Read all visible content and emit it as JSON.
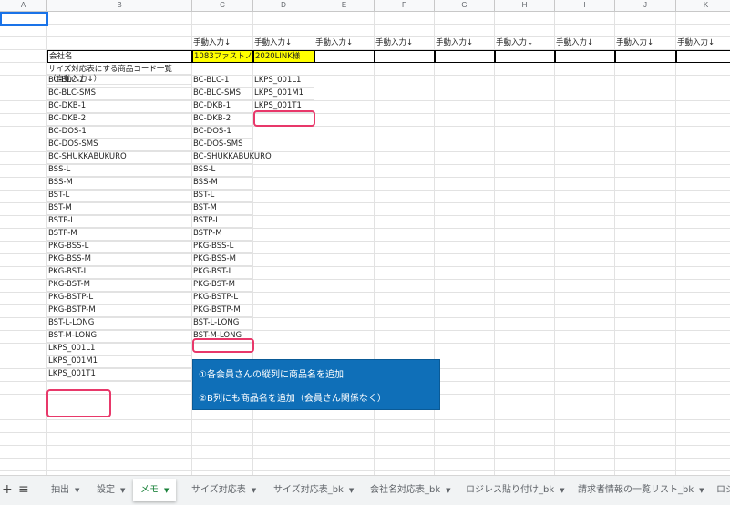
{
  "sheet": {
    "columns": [
      "A",
      "B",
      "C",
      "D",
      "E",
      "F",
      "G",
      "H",
      "I",
      "J",
      "K"
    ],
    "header_manual_input": "手動入力↓",
    "company_label": "会社名",
    "company_values": [
      "1083ファストノ",
      "2020LINK様"
    ],
    "size_list_label_line1": "サイズ対応表にする商品コード一覧",
    "size_list_label_line2": "（自動入力↓）",
    "col_b_codes": [
      "BC-BLC-1",
      "BC-BLC-SMS",
      "BC-DKB-1",
      "BC-DKB-2",
      "BC-DOS-1",
      "BC-DOS-SMS",
      "BC-SHUKKABUKURO",
      "BSS-L",
      "BSS-M",
      "BST-L",
      "BST-M",
      "BSTP-L",
      "BSTP-M",
      "PKG-BSS-L",
      "PKG-BSS-M",
      "PKG-BST-L",
      "PKG-BST-M",
      "PKG-BSTP-L",
      "PKG-BSTP-M",
      "BST-L-LONG",
      "BST-M-LONG",
      "LKPS_001L1",
      "LKPS_001M1",
      "LKPS_001T1"
    ],
    "col_c_codes": [
      "BC-BLC-1",
      "BC-BLC-SMS",
      "BC-DKB-1",
      "BC-DKB-2",
      "BC-DOS-1",
      "BC-DOS-SMS",
      "BC-SHUKKABUKURO",
      "BSS-L",
      "BSS-M",
      "BST-L",
      "BST-M",
      "BSTP-L",
      "BSTP-M",
      "PKG-BSS-L",
      "PKG-BSS-M",
      "PKG-BST-L",
      "PKG-BST-M",
      "PKG-BSTP-L",
      "PKG-BSTP-M",
      "BST-L-LONG",
      "BST-M-LONG"
    ],
    "col_d_codes": [
      "LKPS_001L1",
      "LKPS_001M1",
      "LKPS_001T1"
    ]
  },
  "callout": {
    "line1": "①各会員さんの縦列に商品名を追加",
    "line2": "②B列にも商品名を追加（会員さん関係なく）"
  },
  "colors": {
    "highlight_yellow": "#ffff00",
    "annotation_red": "#e8386a",
    "callout_blue": "#0f6fb8",
    "active_tab_green": "#188038"
  },
  "tabbar": {
    "add_icon": "+",
    "list_icon": "≡",
    "tabs": [
      {
        "label": "抽出"
      },
      {
        "label": "設定"
      },
      {
        "label": "メモ"
      },
      {
        "label": "サイズ対応表"
      },
      {
        "label": "サイズ対応表_bk"
      },
      {
        "label": "会社名対応表_bk"
      },
      {
        "label": "ロジレス貼り付け_bk"
      },
      {
        "label": "請求者情報の一覧リスト_bk"
      },
      {
        "label": "ロジ"
      }
    ]
  }
}
